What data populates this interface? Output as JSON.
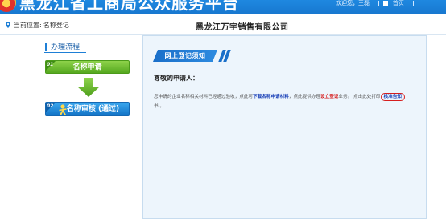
{
  "header": {
    "site_title": "黑龙江省工商局公众服务平台",
    "welcome": "欢迎您，王磊",
    "home": "首页"
  },
  "location": {
    "label": "当前位置:",
    "value": "名称登记"
  },
  "company_title": "黑龙江万宇销售有限公司",
  "left": {
    "flow_heading": "办理流程",
    "steps": [
      {
        "num": "01",
        "label": "名称申请"
      },
      {
        "num": "02",
        "label": "名称审核 (通过)"
      }
    ]
  },
  "notice": {
    "title": "网上登记须知",
    "greeting": "尊敬的申请人：",
    "text_1": "您申请的企业名称相关材料已经通过验收，点此可",
    "link_download": "下载名称申请材料",
    "text_2": "，点此提供办理",
    "link_establish": "设立登记",
    "text_3": "业务。 点击此处打印",
    "link_notice": "核准告知",
    "text_tail": "书 。"
  },
  "colors": {
    "header_blue": "#1777cf",
    "step_green": "#55a81f",
    "step_blue": "#1576c8",
    "panel_bg": "#edf5fc",
    "link_blue": "#1d43b8",
    "link_red": "#d62020"
  }
}
